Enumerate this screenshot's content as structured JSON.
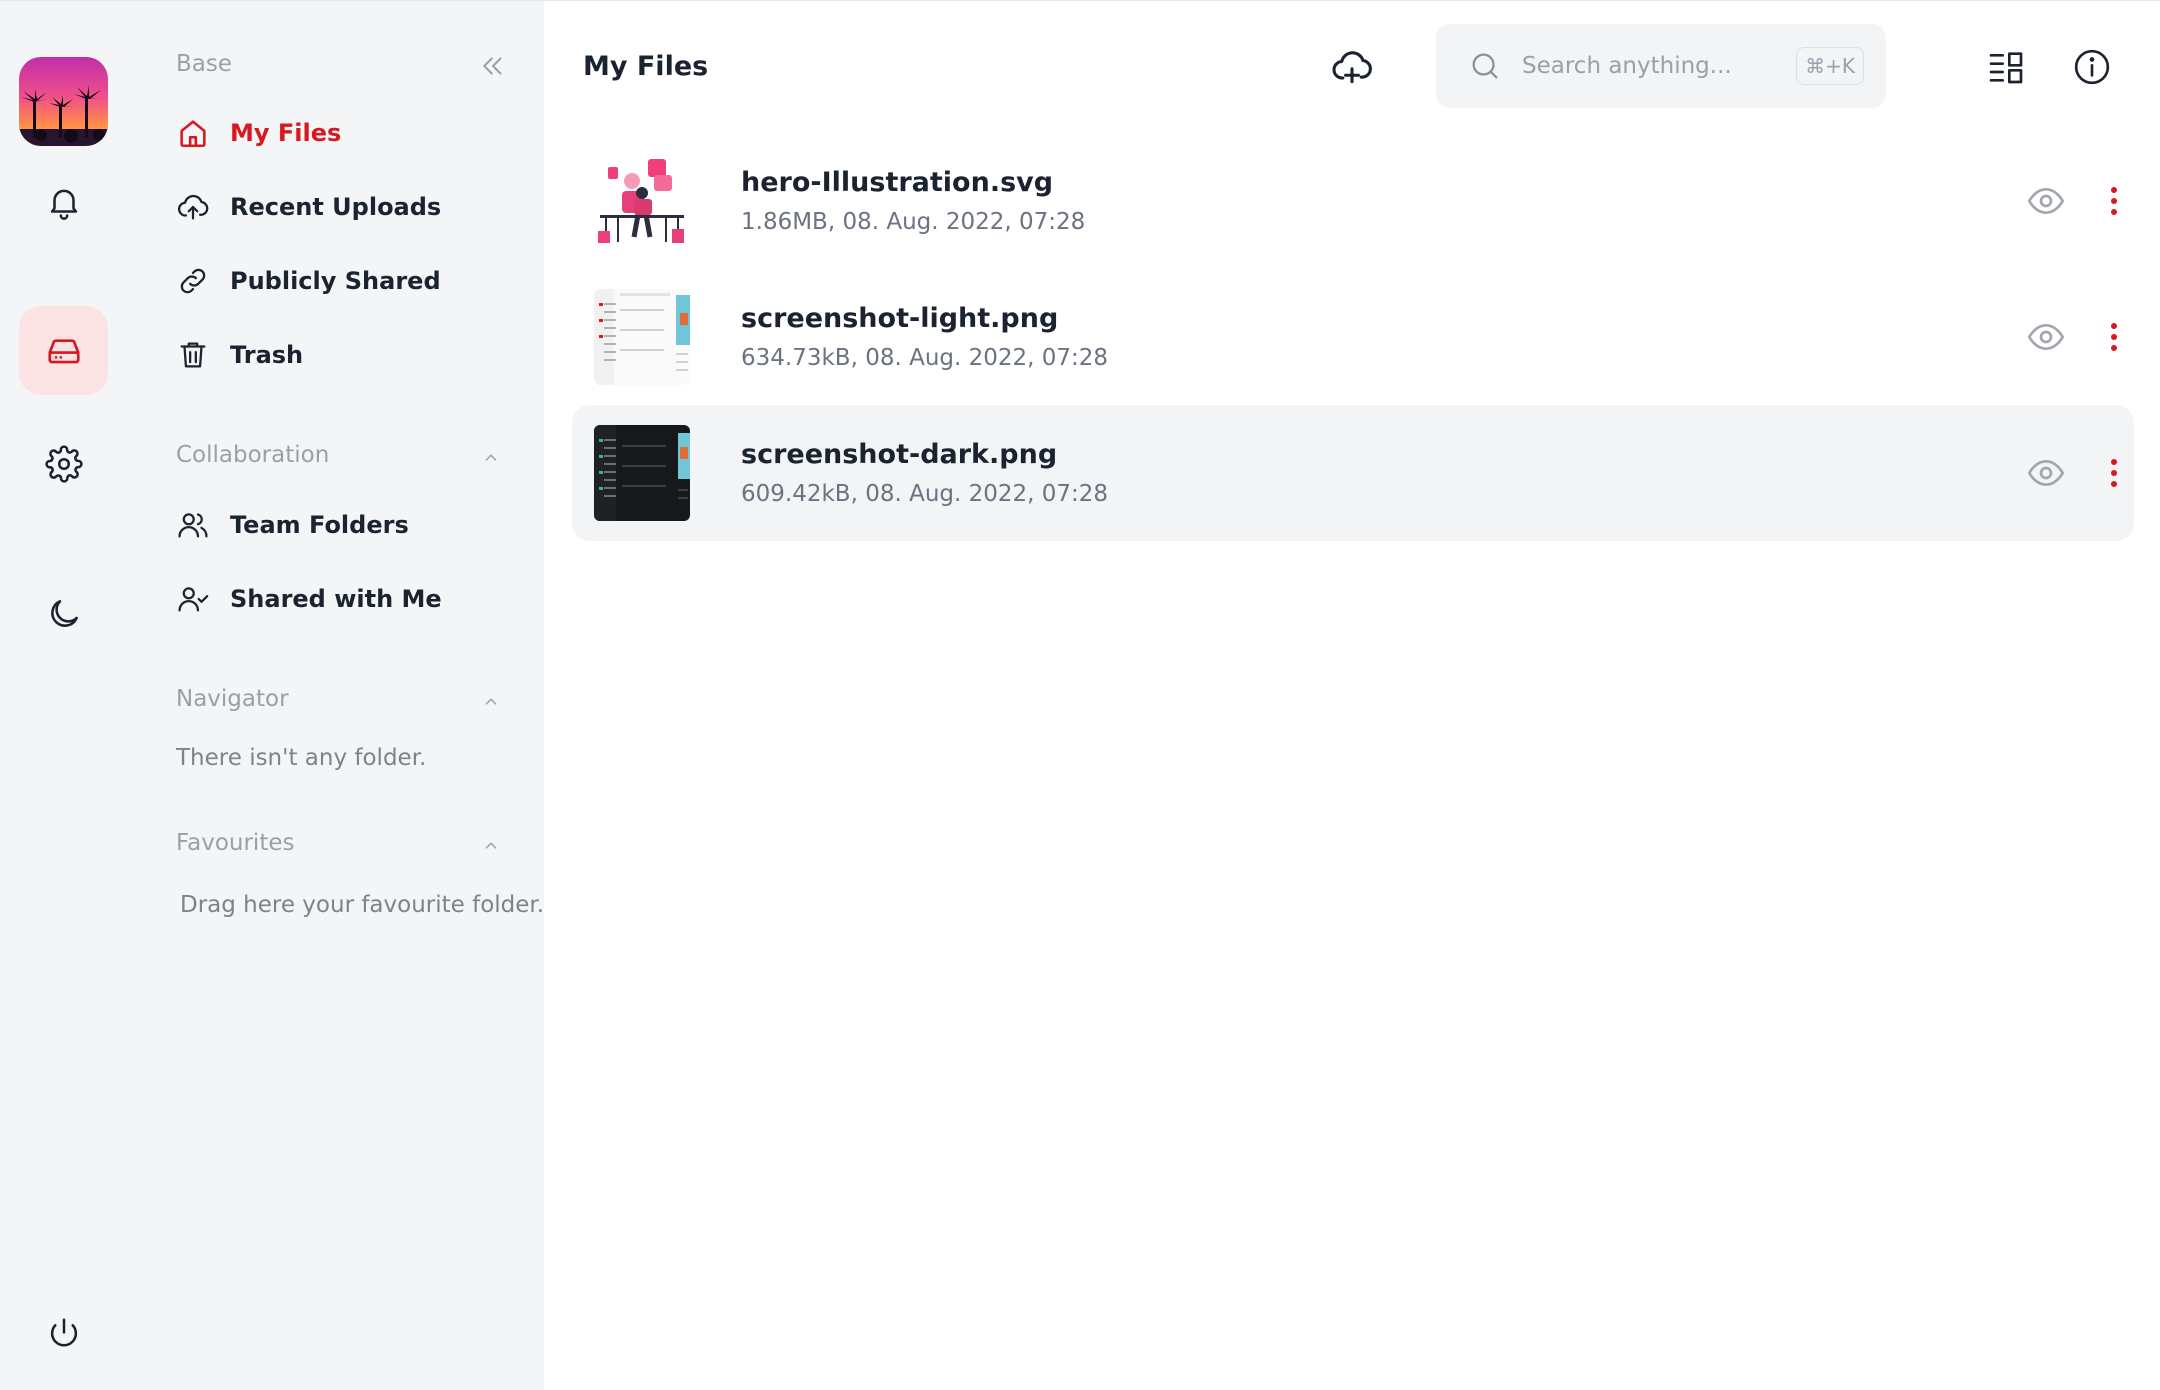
{
  "colors": {
    "accent": "#d7191f",
    "sidebar_bg": "#f4f5f6",
    "selected_row": "#f3f4f6"
  },
  "rail": {
    "icons": [
      "avatar",
      "bell-icon",
      "drive-icon",
      "gear-icon",
      "moon-icon",
      "power-icon"
    ]
  },
  "sidebar": {
    "base_title": "Base",
    "base_items": [
      {
        "label": "My Files",
        "icon": "home-icon"
      },
      {
        "label": "Recent Uploads",
        "icon": "cloud-upload-icon"
      },
      {
        "label": "Publicly Shared",
        "icon": "link-icon"
      },
      {
        "label": "Trash",
        "icon": "trash-icon"
      }
    ],
    "collaboration_title": "Collaboration",
    "collaboration_items": [
      {
        "label": "Team Folders",
        "icon": "users-icon"
      },
      {
        "label": "Shared with Me",
        "icon": "user-check-icon"
      }
    ],
    "navigator_title": "Navigator",
    "navigator_empty": "There isn't any folder.",
    "favourites_title": "Favourites",
    "favourites_empty": "Drag here your favourite folder."
  },
  "header": {
    "title": "My Files",
    "search_placeholder": "Search anything...",
    "search_shortcut": "⌘+K"
  },
  "files": [
    {
      "name": "hero-Illustration.svg",
      "meta": "1.86MB, 08. Aug. 2022, 07:28"
    },
    {
      "name": "screenshot-light.png",
      "meta": "634.73kB, 08. Aug. 2022, 07:28"
    },
    {
      "name": "screenshot-dark.png",
      "meta": "609.42kB, 08. Aug. 2022, 07:28"
    }
  ]
}
